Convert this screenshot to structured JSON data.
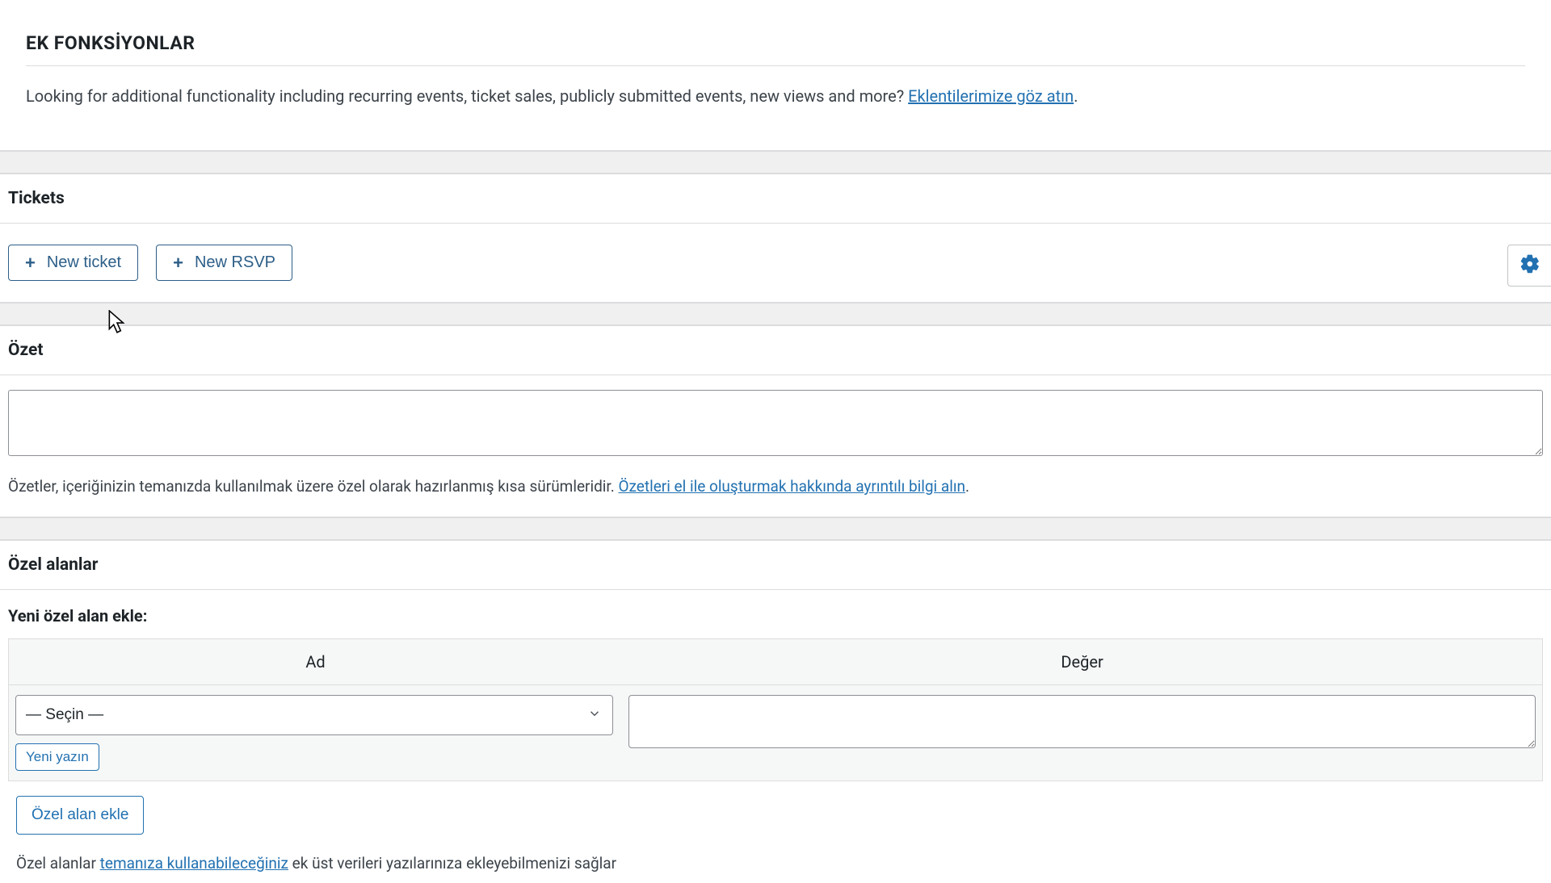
{
  "addons": {
    "title": "EK FONKSİYONLAR",
    "desc": "Looking for additional functionality including recurring events, ticket sales, publicly submitted events, new views and more? ",
    "link": "Eklentilerimize göz atın",
    "period": "."
  },
  "tickets": {
    "title": "Tickets",
    "new_ticket": "New ticket",
    "new_rsvp": "New RSVP"
  },
  "ozet": {
    "title": "Özet",
    "value": "",
    "desc_before": "Özetler, içeriğinizin temanızda kullanılmak üzere özel olarak hazırlanmış kısa sürümleridir. ",
    "desc_link": "Özetleri el ile oluşturmak hakkında ayrıntılı bilgi alın",
    "period": "."
  },
  "ozel": {
    "title": "Özel alanlar",
    "sublabel": "Yeni özel alan ekle:",
    "col_name": "Ad",
    "col_value": "Değer",
    "select_value": "— Seçin —",
    "enter_new": "Yeni yazın",
    "add_field": "Özel alan ekle",
    "bottom_before": "Özel alanlar ",
    "bottom_link": "temanıza kullanabileceğiniz",
    "bottom_after": " ek üst verileri yazılarınıza ekleyebilmenizi sağlar"
  }
}
